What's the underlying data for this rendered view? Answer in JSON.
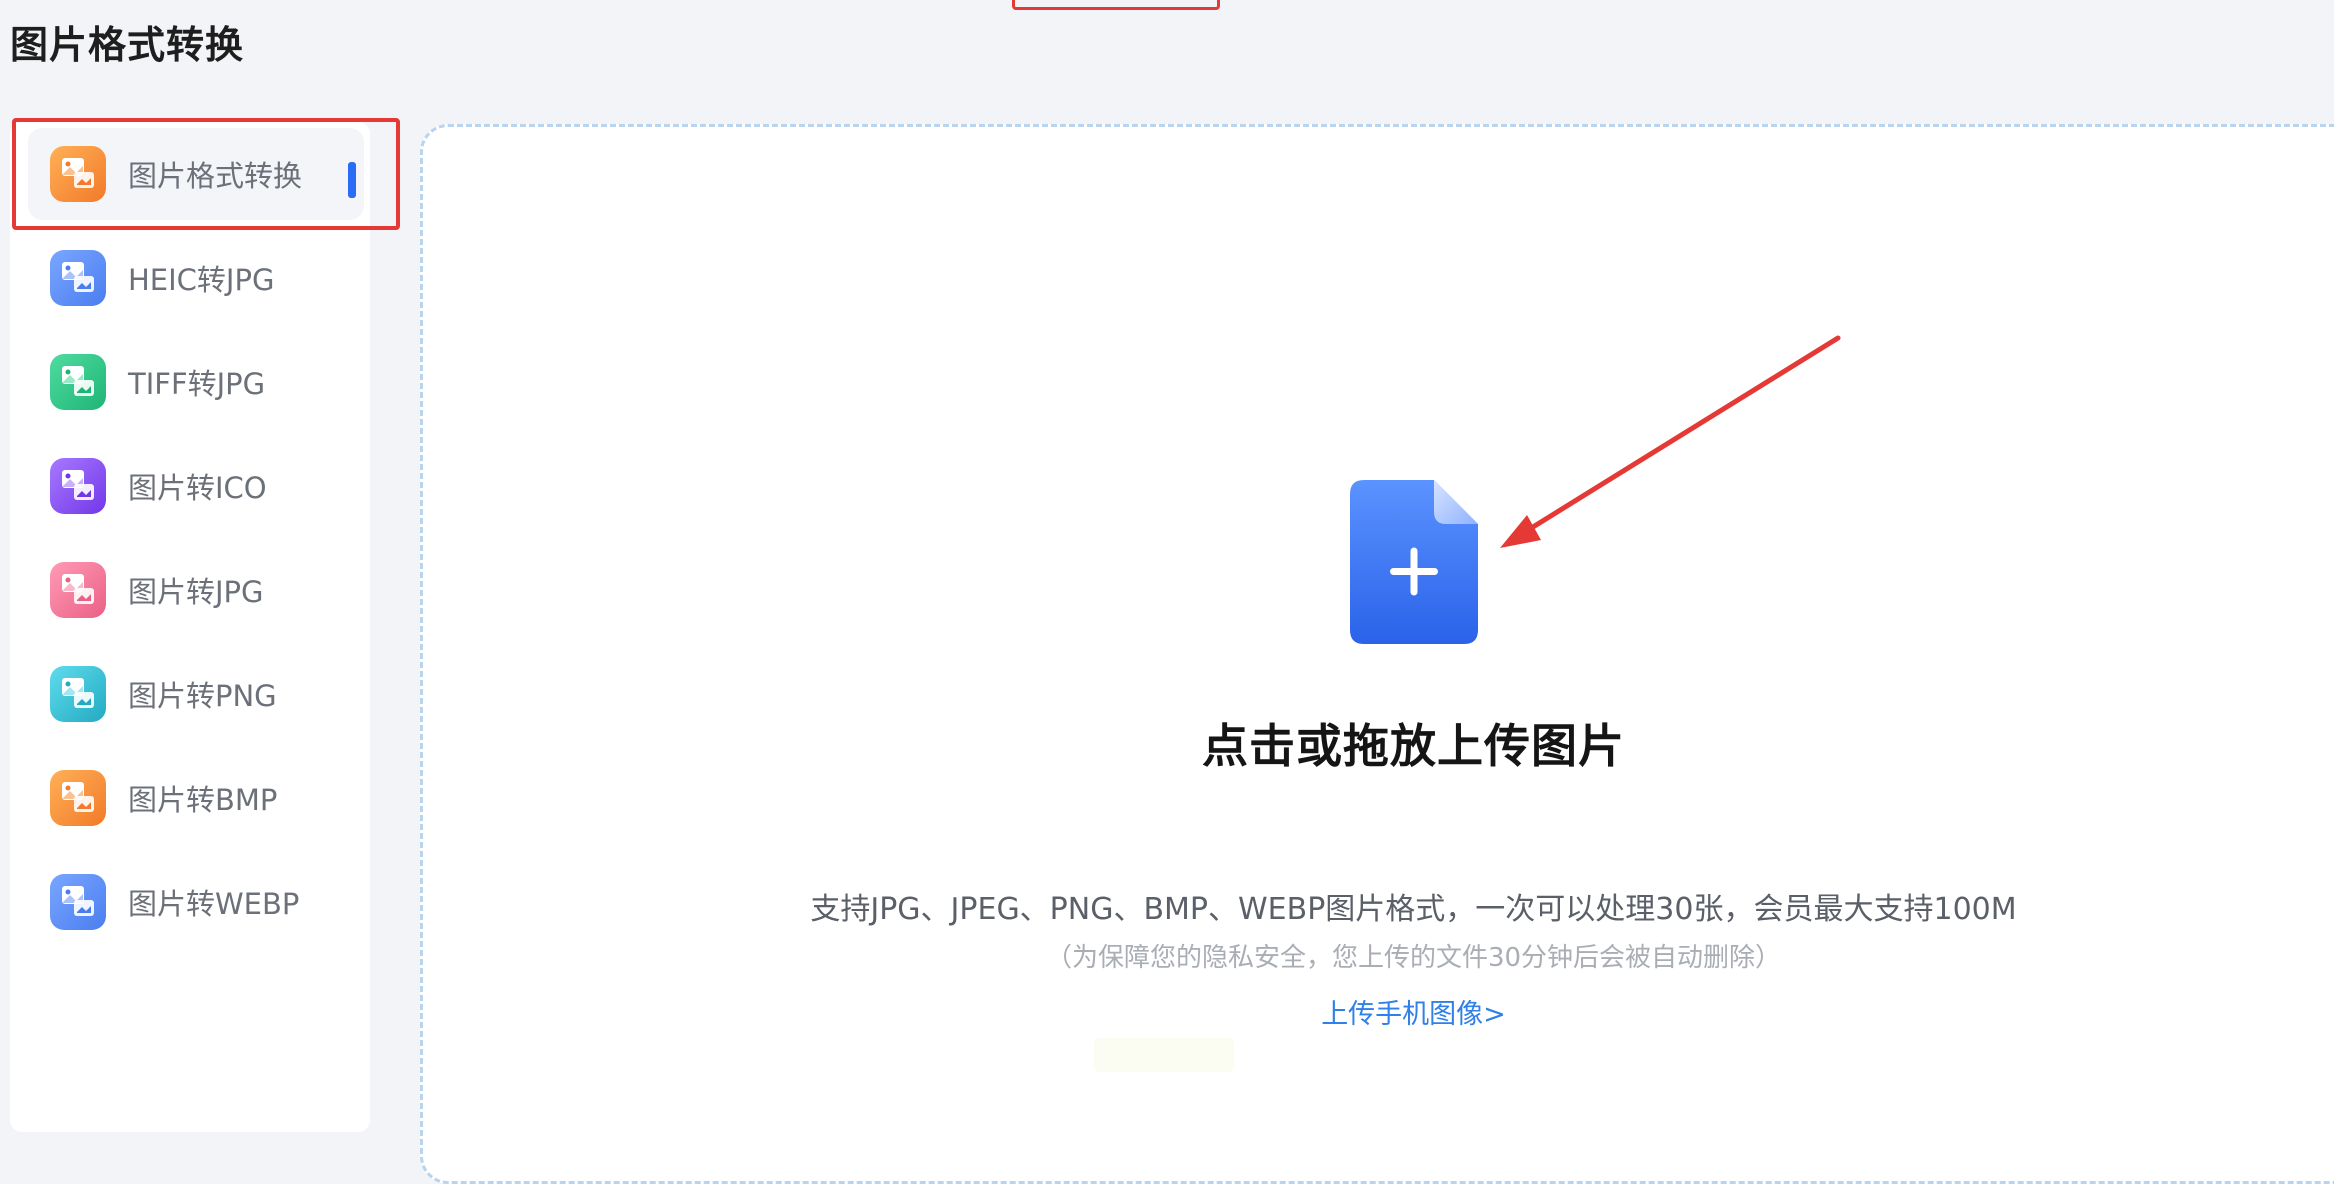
{
  "page": {
    "title": "图片格式转换"
  },
  "sidebar": {
    "items": [
      {
        "label": "图片格式转换",
        "icon": "image-convert-icon",
        "color": "#f7913c",
        "active": true
      },
      {
        "label": "HEIC转JPG",
        "icon": "heic-to-jpg-icon",
        "color": "#5b8ff5",
        "active": false
      },
      {
        "label": "TIFF转JPG",
        "icon": "tiff-to-jpg-icon",
        "color": "#2ec78b",
        "active": false
      },
      {
        "label": "图片转ICO",
        "icon": "image-to-ico-icon",
        "color": "#8a4ff0",
        "active": false
      },
      {
        "label": "图片转JPG",
        "icon": "image-to-jpg-icon",
        "color": "#f27a9b",
        "active": false
      },
      {
        "label": "图片转PNG",
        "icon": "image-to-png-icon",
        "color": "#35bfd6",
        "active": false
      },
      {
        "label": "图片转BMP",
        "icon": "image-to-bmp-icon",
        "color": "#f7913c",
        "active": false
      },
      {
        "label": "图片转WEBP",
        "icon": "image-to-webp-icon",
        "color": "#5b8ff5",
        "active": false
      }
    ]
  },
  "upload": {
    "title": "点击或拖放上传图片",
    "formats_text": "支持JPG、JPEG、PNG、BMP、WEBP图片格式，一次可以处理30张，会员最大支持100M",
    "privacy_note": "（为保障您的隐私安全，您上传的文件30分钟后会被自动删除）",
    "mobile_link": "上传手机图像>",
    "icon": "file-add-icon",
    "icon_color": "#3a7af5"
  },
  "annotations": {
    "highlight_color": "#e53935",
    "arrow_color": "#e53935"
  }
}
